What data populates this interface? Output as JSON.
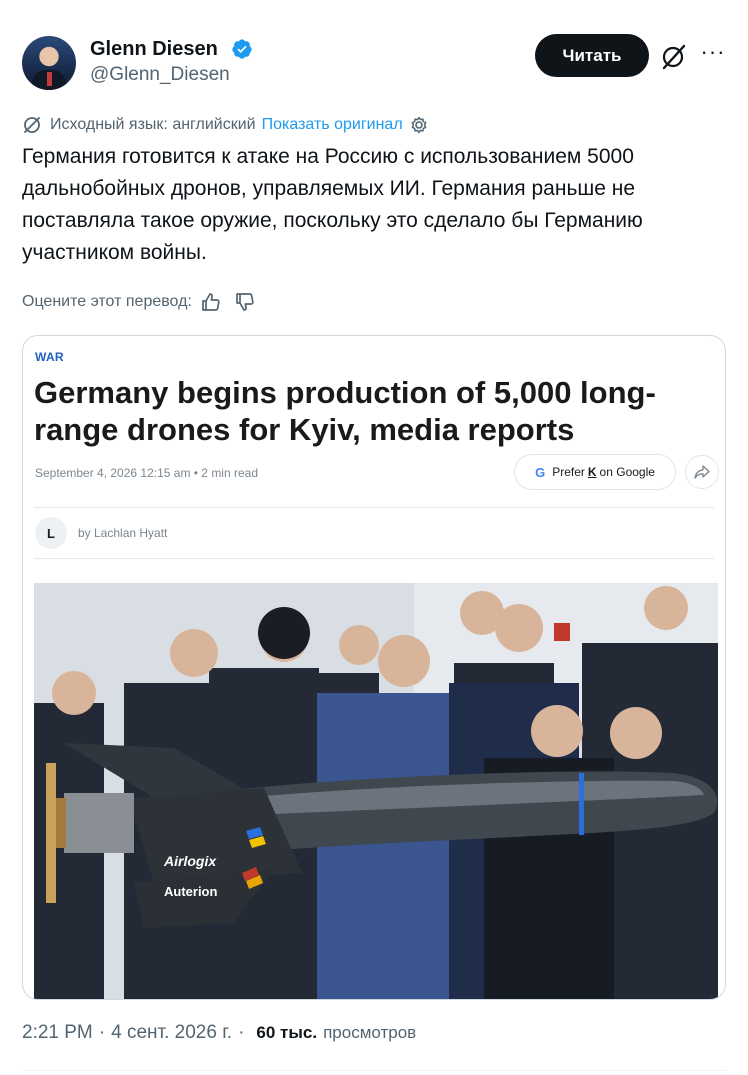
{
  "author": {
    "name": "Glenn Diesen",
    "handle": "@Glenn_Diesen",
    "follow_label": "Читать"
  },
  "translation": {
    "source_note": "Исходный язык: английский",
    "show_original": "Показать оригинал",
    "rate_label": "Оцените этот перевод:"
  },
  "tweet": {
    "text": "Германия готовится к атаке на Россию с использованием 5000 дальнобойных дронов, управляемых ИИ. Германия раньше не поставляла такое оружие, поскольку это сделало бы Германию участником войны."
  },
  "card": {
    "category": "WAR",
    "headline": "Germany begins production of 5,000 long-range drones for Kyiv, media reports",
    "meta": "September 4, 2026 12:15 am • 2 min read",
    "prefer_pre": "Prefer",
    "prefer_k": "K",
    "prefer_post": "on Google",
    "author_initial": "L",
    "author_byline": "by Lachlan Hyatt",
    "photo_text": {
      "brand1": "Airlogix",
      "brand2": "Auterion"
    }
  },
  "footer": {
    "time": "2:21 PM",
    "date": "4 сент. 2026 г.",
    "views_count": "60 тыс.",
    "views_label": "просмотров"
  },
  "colors": {
    "accent": "#1d9bf0",
    "card_category": "#1f5fbf",
    "text_secondary": "#536471"
  },
  "icons": [
    "verified-badge-icon",
    "grok-icon",
    "more-icon",
    "translate-icon",
    "gear-icon",
    "thumbs-up-icon",
    "thumbs-down-icon",
    "google-icon",
    "share-icon"
  ]
}
